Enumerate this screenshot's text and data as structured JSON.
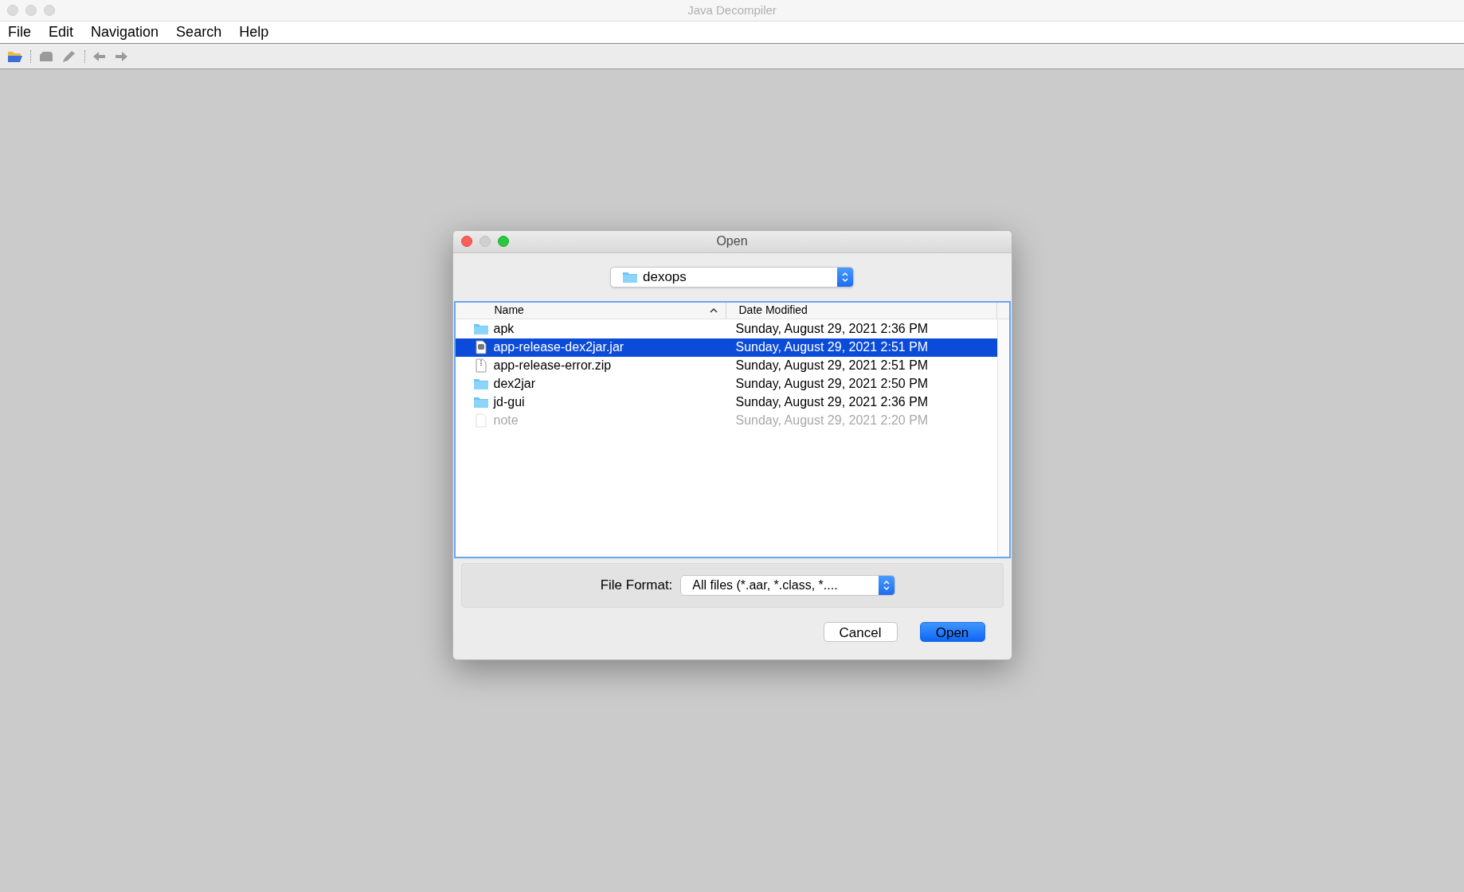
{
  "window": {
    "title": "Java Decompiler"
  },
  "menu": [
    "File",
    "Edit",
    "Navigation",
    "Search",
    "Help"
  ],
  "toolbar": [
    {
      "kind": "open",
      "disabled": false
    },
    {
      "kind": "separator"
    },
    {
      "kind": "close",
      "disabled": true
    },
    {
      "kind": "edit",
      "disabled": true
    },
    {
      "kind": "separator"
    },
    {
      "kind": "back",
      "disabled": true
    },
    {
      "kind": "forward",
      "disabled": true
    }
  ],
  "dialog": {
    "title": "Open",
    "location": "dexops",
    "columns": [
      "Name",
      "Date Modified"
    ],
    "rows": [
      {
        "kind": "folder",
        "name": "apk",
        "date": "Sunday, August 29, 2021 2:36 PM",
        "selected": false,
        "disabled": false
      },
      {
        "kind": "jar",
        "name": "app-release-dex2jar.jar",
        "date": "Sunday, August 29, 2021 2:51 PM",
        "selected": true,
        "disabled": false
      },
      {
        "kind": "zip",
        "name": "app-release-error.zip",
        "date": "Sunday, August 29, 2021 2:51 PM",
        "selected": false,
        "disabled": false
      },
      {
        "kind": "folder",
        "name": "dex2jar",
        "date": "Sunday, August 29, 2021 2:50 PM",
        "selected": false,
        "disabled": false
      },
      {
        "kind": "folder",
        "name": "jd-gui",
        "date": "Sunday, August 29, 2021 2:36 PM",
        "selected": false,
        "disabled": false
      },
      {
        "kind": "file",
        "name": "note",
        "date": "Sunday, August 29, 2021 2:20 PM",
        "selected": false,
        "disabled": true
      }
    ],
    "file_format": {
      "label": "File Format:",
      "value": "All files (*.aar, *.class, *...."
    },
    "buttons": [
      {
        "label": "Cancel",
        "default": false
      },
      {
        "label": "Open",
        "default": true
      }
    ]
  }
}
